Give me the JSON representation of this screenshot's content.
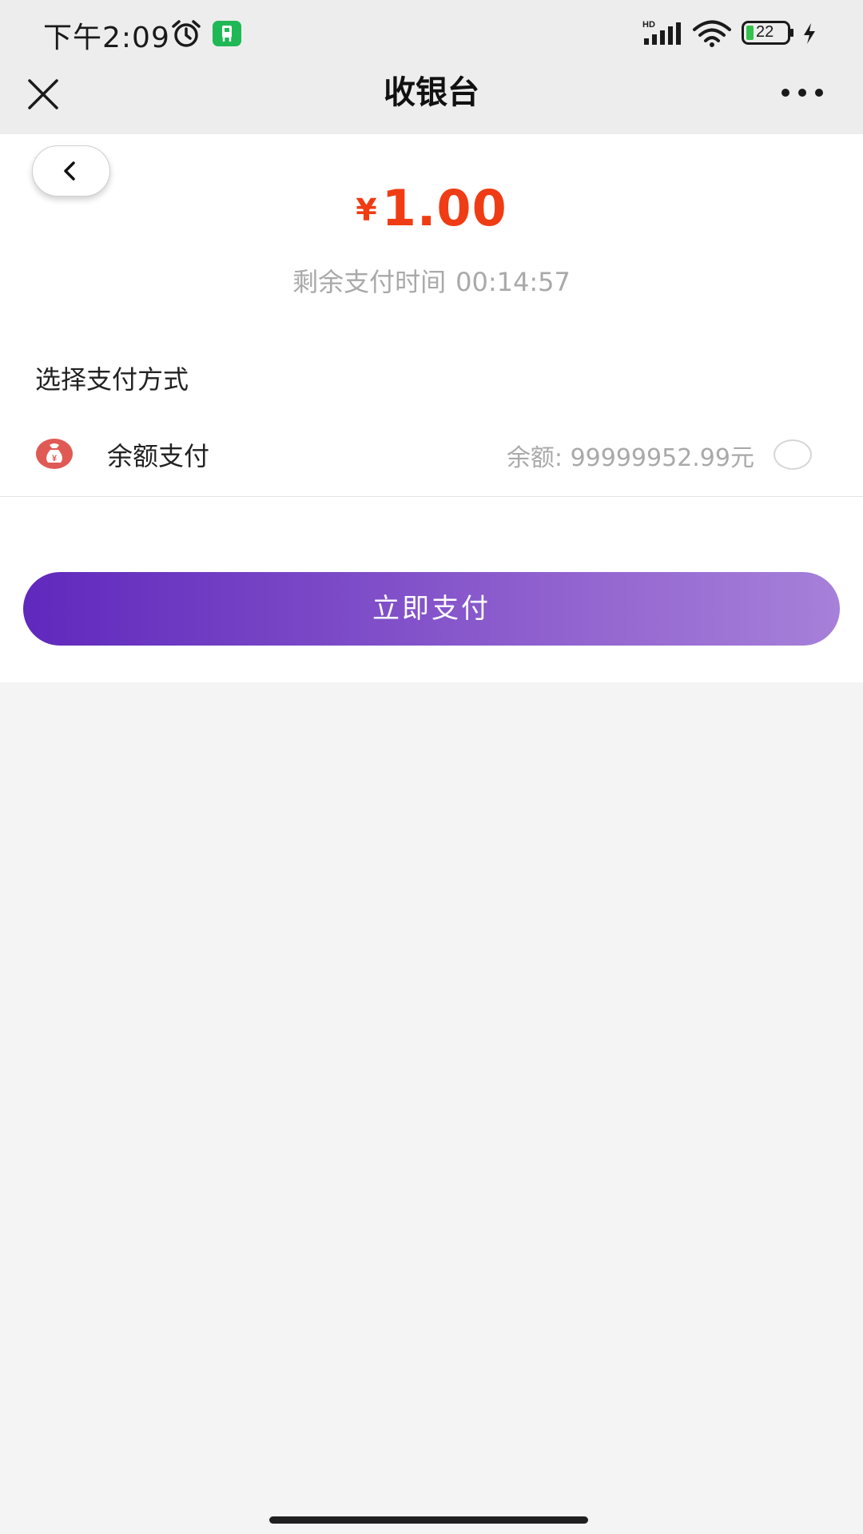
{
  "status_bar": {
    "time": "下午2:09",
    "battery": "22",
    "network_badge": "HD",
    "icons": [
      "alarm-icon",
      "app-notification-icon",
      "signal-icon",
      "wifi-icon",
      "battery-icon",
      "charging-icon"
    ]
  },
  "nav": {
    "title": "收银台",
    "close_icon": "close-icon",
    "more_icon": "more-icon"
  },
  "payment": {
    "currency_symbol": "¥",
    "amount": "1.00",
    "countdown_label": "剩余支付时间",
    "countdown_time": "00:14:57",
    "section_title": "选择支付方式",
    "methods": [
      {
        "label": "余额支付",
        "balance_text": "余额: 99999952.99元",
        "icon": "money-bag-icon",
        "selected": false
      }
    ],
    "pay_button": "立即支付"
  },
  "colors": {
    "amount": "#ef3c14",
    "button_gradient_start": "#6028bd",
    "button_gradient_end": "#a680d9",
    "method_icon": "#e05a55",
    "background": "#f4f4f4"
  }
}
